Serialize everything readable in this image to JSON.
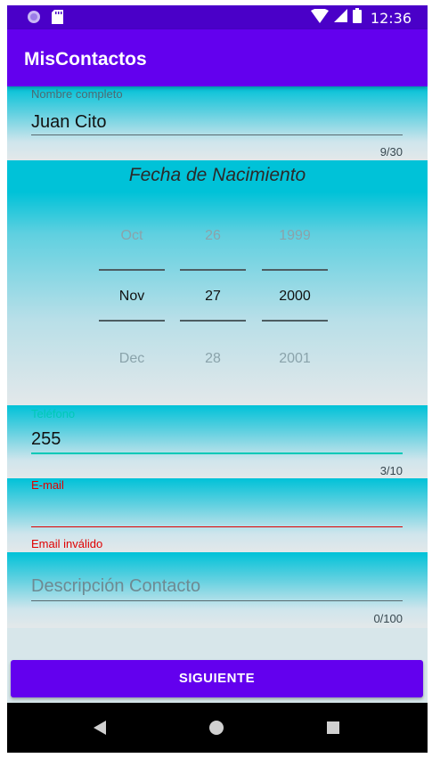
{
  "statusbar": {
    "time": "12:36",
    "icons": [
      "circle-app-icon",
      "sd-card-icon",
      "wifi-icon",
      "signal-icon",
      "battery-icon"
    ]
  },
  "appbar": {
    "title": "MisContactos"
  },
  "name_field": {
    "label": "Nombre completo",
    "value": "Juan Cito",
    "counter": "9/30"
  },
  "date_picker": {
    "title": "Fecha de Nacimiento",
    "month": {
      "prev": "Oct",
      "selected": "Nov",
      "next": "Dec"
    },
    "day": {
      "prev": "26",
      "selected": "27",
      "next": "28"
    },
    "year": {
      "prev": "1999",
      "selected": "2000",
      "next": "2001"
    }
  },
  "phone_field": {
    "label": "Teléfono",
    "value": "255",
    "counter": "3/10"
  },
  "email_field": {
    "label": "E-mail",
    "value": "",
    "error": "Email inválido"
  },
  "description_field": {
    "placeholder": "Descripción Contacto",
    "counter": "0/100"
  },
  "button": {
    "label": "SIGUIENTE"
  },
  "colors": {
    "primary": "#6300ee",
    "status_bar": "#4a00c8",
    "accent": "#00c9b7",
    "error": "#e00000"
  }
}
